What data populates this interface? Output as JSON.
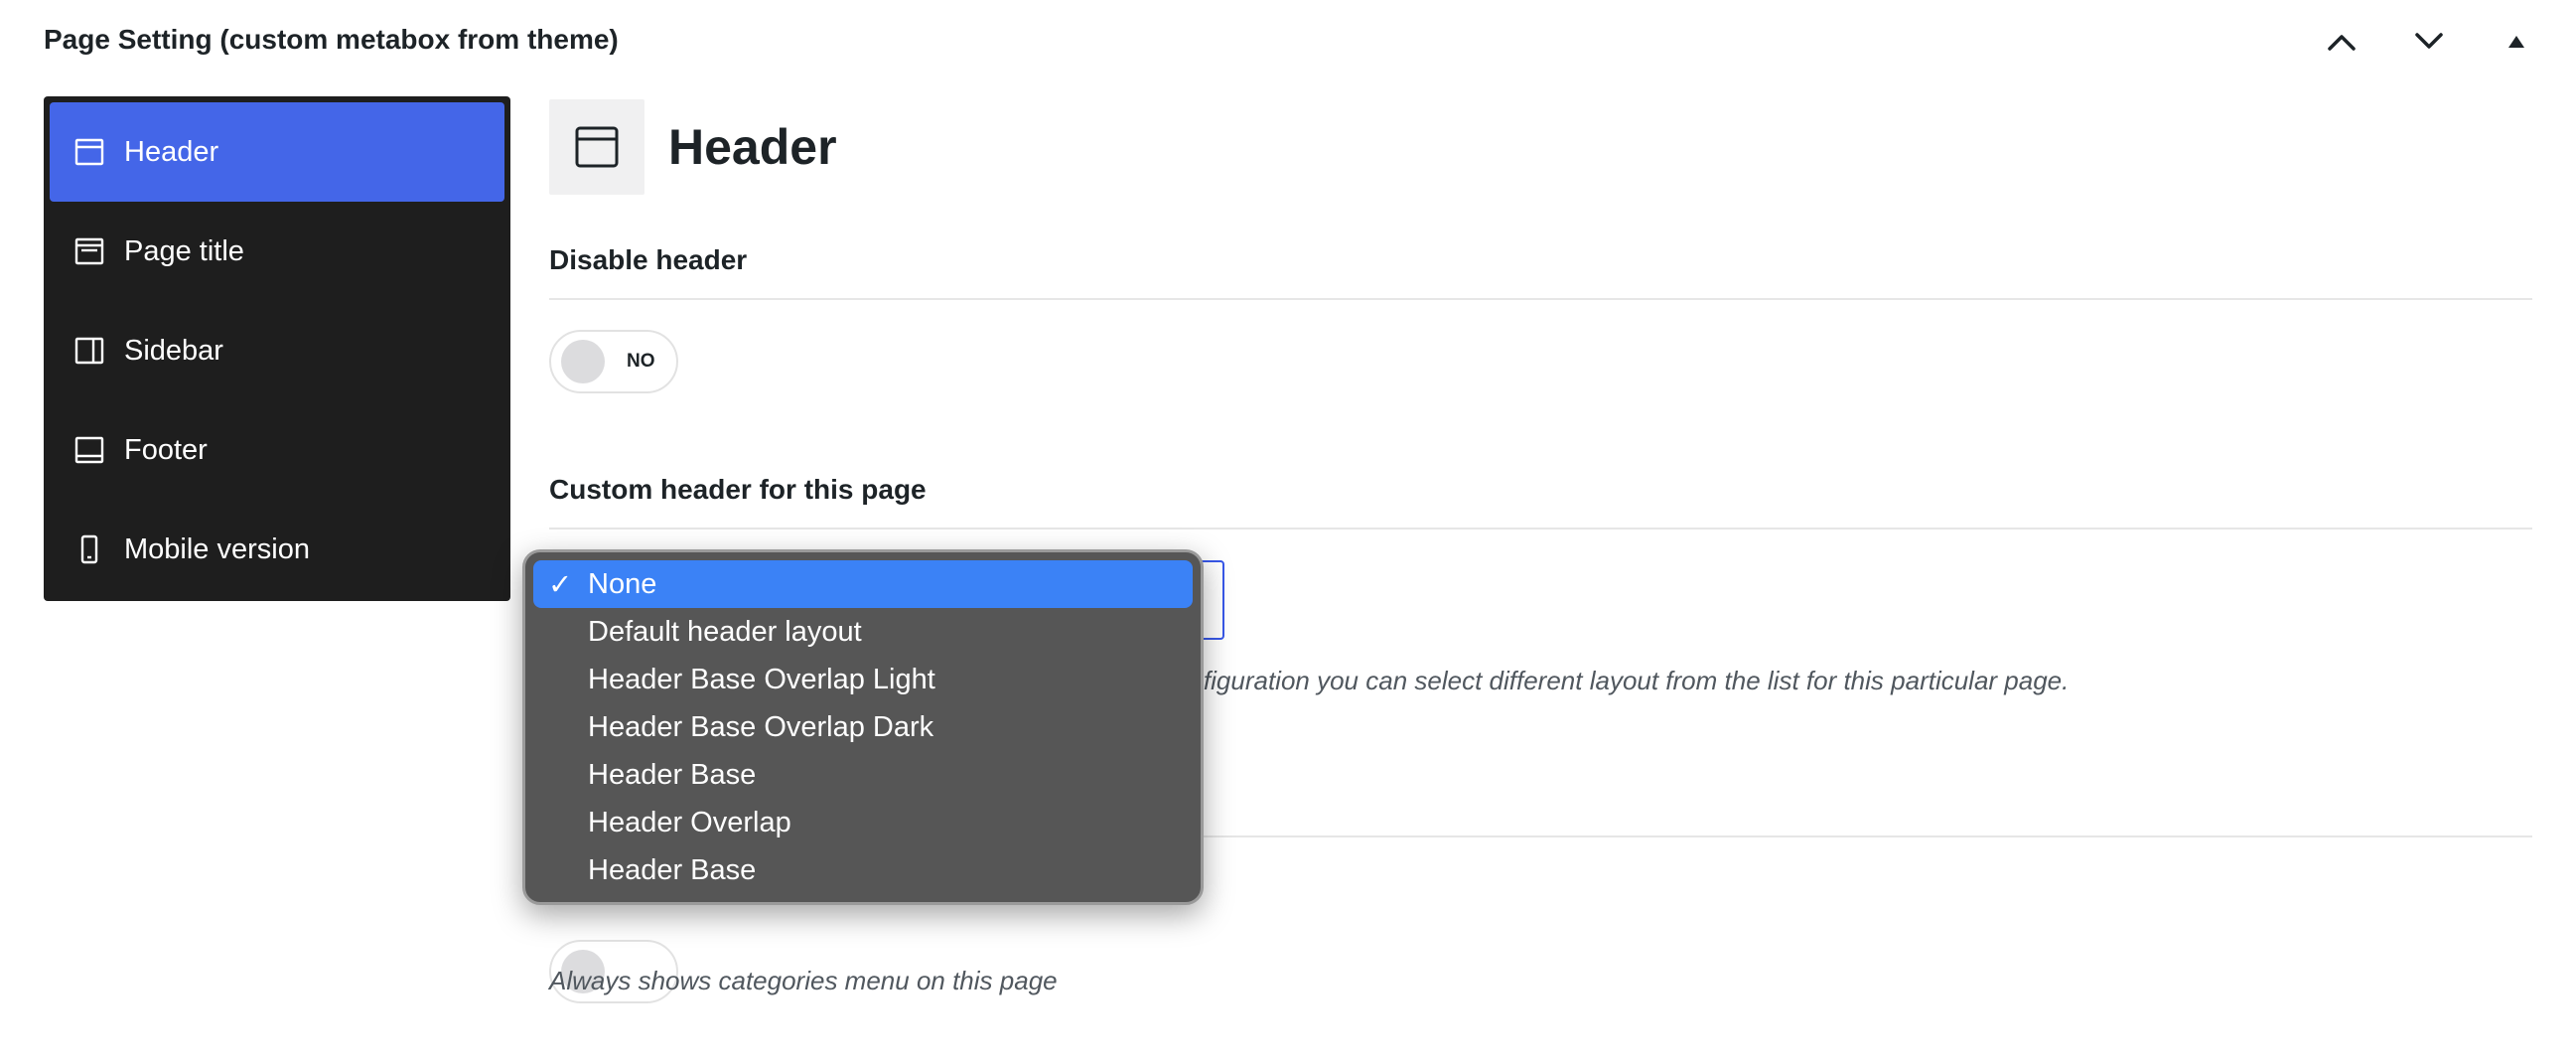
{
  "panel": {
    "title": "Page Setting (custom metabox from theme)",
    "controls": [
      "move-up",
      "move-down",
      "toggle-panel"
    ]
  },
  "sidebar": {
    "items": [
      {
        "label": "Header",
        "icon": "header-layout-icon",
        "active": true
      },
      {
        "label": "Page title",
        "icon": "page-title-icon",
        "active": false
      },
      {
        "label": "Sidebar",
        "icon": "sidebar-layout-icon",
        "active": false
      },
      {
        "label": "Footer",
        "icon": "footer-layout-icon",
        "active": false
      },
      {
        "label": "Mobile version",
        "icon": "mobile-icon",
        "active": false
      }
    ]
  },
  "section": {
    "title": "Header",
    "icon": "header-layout-icon",
    "disable_header": {
      "label": "Disable header",
      "toggle_text": "NO",
      "value": false
    },
    "custom_header": {
      "label": "Custom header for this page",
      "selected": "None",
      "help_visible_fragment": "onfiguration you can select different layout from the list for this particular page."
    },
    "categories_menu": {
      "help": "Always shows categories menu on this page"
    }
  },
  "dropdown": {
    "options": [
      {
        "label": "None",
        "selected": true
      },
      {
        "label": "Default header layout",
        "selected": false
      },
      {
        "label": "Header Base Overlap Light",
        "selected": false
      },
      {
        "label": "Header Base Overlap Dark",
        "selected": false
      },
      {
        "label": "Header Base",
        "selected": false
      },
      {
        "label": "Header Overlap",
        "selected": false
      },
      {
        "label": "Header Base",
        "selected": false
      }
    ],
    "check_glyph": "✓"
  },
  "colors": {
    "accent": "#4466e8",
    "sidebar_bg": "#1e1e1e",
    "dropdown_bg": "#565656",
    "dropdown_selected": "#3b82f6",
    "select_border": "#3858e9"
  }
}
